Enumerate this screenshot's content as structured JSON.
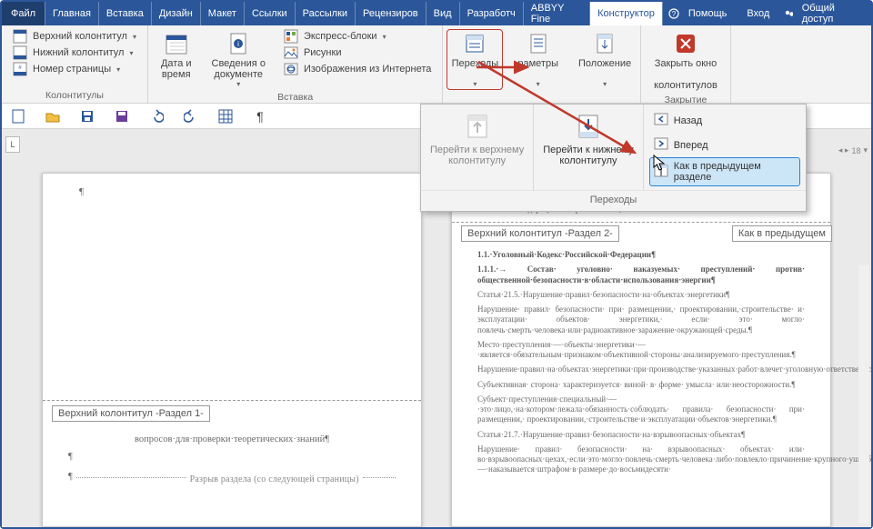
{
  "tabs": {
    "file": "Файл",
    "items": [
      "Главная",
      "Вставка",
      "Дизайн",
      "Макет",
      "Ссылки",
      "Рассылки",
      "Рецензиров",
      "Вид",
      "Разработч",
      "ABBYY Fine",
      "Конструктор"
    ],
    "help": "Помощь",
    "signin": "Вход",
    "share": "Общий доступ"
  },
  "ribbon": {
    "g1": {
      "top": "Верхний колонтитул",
      "bot": "Нижний колонтитул",
      "pg": "Номер страницы",
      "label": "Колонтитулы"
    },
    "g2": {
      "date": "Дата и\nвремя",
      "doc": "Сведения о\nдокументе",
      "exp": "Экспресс-блоки",
      "pic": "Рисунки",
      "net": "Изображения из Интернета",
      "label": "Вставка"
    },
    "g3": {
      "trans": "Переходы",
      "params": "раметры",
      "pos": "Положение"
    },
    "g4": {
      "close1": "Закрыть окно",
      "close2": "колонтитулов",
      "label": "Закрытие"
    }
  },
  "popup": {
    "goTop": "Перейти к верхнему\nколонтитулу",
    "goBot": "Перейти к нижнему\nколонтитулу",
    "back": "Назад",
    "fwd": "Вперед",
    "link": "Как в предыдущем разделе",
    "footer": "Переходы"
  },
  "rulers": {
    "left": "L",
    "right": "18"
  },
  "pageLeft": {
    "tag": "Верхний колонтитул -Раздел 1-",
    "body1": "вопросов·для·проверки·теоретических·знаний¶",
    "break": "Разрыв раздела (со следующей страницы)"
  },
  "pageRight": {
    "tagL": "Верхний колонтитул -Раздел 2-",
    "tagR": "Как в предыдущем",
    "hdr_frag": "оссийской·  Федерации·  в·строительства¶",
    "h1": "1.1.·Уголовный·Кодекс·Российской·Федерации¶",
    "p11": "1.1.1.·→ Состав· уголовно· наказуемых· преступлений· против· общественной·безопасности·в·области·использования·энергии¶",
    "p215": "Статья·21.5.·Нарушение·правил·безопасности·на·объектах·энергетики¶",
    "p215b": "Нарушение· правил· безопасности· при· размещении,· проектировании,·строительстве· и· эксплуатации· объектов· энергетики,· если· это· могло· повлечь·смерть·человека·или·радиоактивное·заражение·окружающей·среды.¶",
    "pmesto": "Место·преступления·—·объекты·энергетики·—·является·обязательным·признаком·объективной·стороны·анализируемого·преступления.¶",
    "pnar": "Нарушение·правил·на·объектах·энергетики·при·производстве·указанных·работ·влечет·уголовную·ответственность·только·в·том·случае,·если·это·могло·повлечь·смерть·человека·или·радиоактивное·заражение·окружающей·среды.¶",
    "psub": "Субъективная· сторона· характеризуется· виной· в· форме· умысла· или·неосторожности.¶",
    "psubj": "Субъект·преступления·специальный·—·это·лицо,·на·котором·лежала·обязанность·соблюдать· правила· безопасности· при· размещении,· проектировании,·строительстве·и·эксплуатации·объектов·энергетики.¶",
    "p217": "Статья·21.7.·Нарушение·правил·безопасности·на·взрывоопасных·объектах¶",
    "p217b": "Нарушение· правил· безопасности· на· взрывоопасных· объектах· или· во·взрывоопасных·цехах,·если·это·могло·повлечь·смерть·человека·либо·повлекло·причинение·крупного·ущерба,·—·наказывается·штрафом·в·размере·до·восьмидесяти·"
  }
}
